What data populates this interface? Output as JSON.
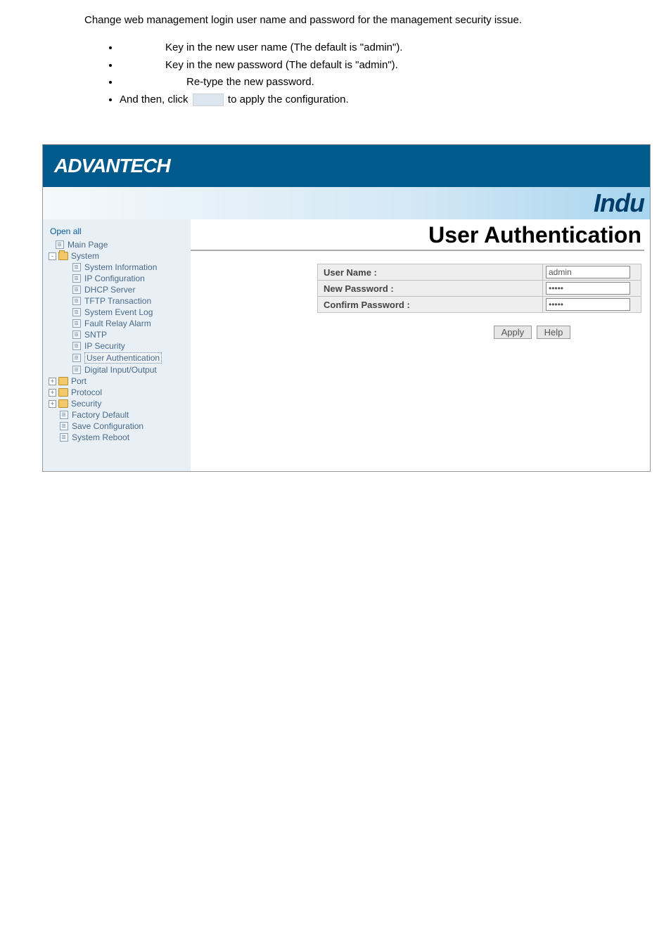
{
  "doc": {
    "intro": "Change web management login user name and password for the management security issue.",
    "b1": "Key in the new user name (The default is \"admin\").",
    "b2": "Key in the new password (The default is \"admin\").",
    "b3": "Re-type the new password.",
    "b4_pre": "And then, click",
    "b4_post": "to apply the configuration."
  },
  "brand": {
    "logo": "ADVANTECH",
    "sub": "Indu"
  },
  "sidebar": {
    "open_all": "Open all",
    "main_page": "Main Page",
    "system": "System",
    "system_children": {
      "0": "System Information",
      "1": "IP Configuration",
      "2": "DHCP Server",
      "3": "TFTP Transaction",
      "4": "System Event Log",
      "5": "Fault Relay Alarm",
      "6": "SNTP",
      "7": "IP Security",
      "8": "User Authentication",
      "9": "Digital Input/Output"
    },
    "port": "Port",
    "protocol": "Protocol",
    "security": "Security",
    "factory_default": "Factory Default",
    "save_config": "Save Configuration",
    "system_reboot": "System Reboot"
  },
  "page": {
    "title": "User Authentication",
    "labels": {
      "user": "User Name :",
      "newpw": "New Password :",
      "confpw": "Confirm Password :"
    },
    "values": {
      "user": "admin",
      "newpw": "•••••",
      "confpw": "•••••"
    },
    "buttons": {
      "apply": "Apply",
      "help": "Help"
    }
  }
}
